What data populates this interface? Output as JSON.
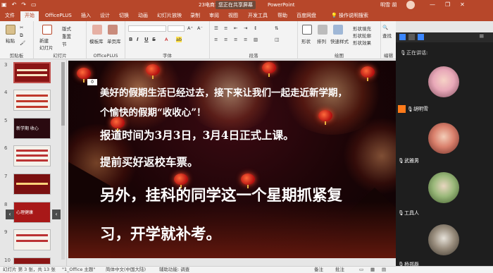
{
  "titlebar": {
    "qat_icons": [
      "save-icon",
      "undo-icon",
      "redo-icon",
      "present-icon"
    ],
    "file_title": "23电商1班",
    "share_badge": "您正在共享屏幕",
    "app_name": "PowerPoint",
    "user_name": "明雪 胡",
    "window_buttons": [
      "—",
      "❐",
      "✕"
    ]
  },
  "ribbon_tabs": {
    "file": "文件",
    "items": [
      "开始",
      "OfficePLUS",
      "插入",
      "设计",
      "切换",
      "动画",
      "幻灯片放映",
      "录制",
      "审阅",
      "视图",
      "开发工具",
      "帮助",
      "百度网盘"
    ],
    "search": "操作说明搜索"
  },
  "ribbon": {
    "clipboard": {
      "paste": "粘贴",
      "label": "剪贴板"
    },
    "slides": {
      "new_slide": "新建\n幻灯片",
      "layout": "版式",
      "reset": "重置",
      "section": "节",
      "label": "幻灯片"
    },
    "officeplus": {
      "template": "模板库",
      "single_page": "单页库",
      "label": "OfficePLUS"
    },
    "font": {
      "bold": "B",
      "italic": "I",
      "underline": "U",
      "strike": "S",
      "label": "字体"
    },
    "paragraph": {
      "label": "段落"
    },
    "drawing": {
      "shape": "形状",
      "arrange": "排列",
      "quick_styles": "快速样式",
      "fill": "形状填充",
      "outline": "形状轮廓",
      "effect": "形状效果",
      "label": "绘图"
    },
    "editing": {
      "find": "查找",
      "label": "编辑"
    }
  },
  "slide_panel": {
    "thumbnails": [
      {
        "num": "3",
        "selected": true,
        "text": ""
      },
      {
        "num": "4",
        "selected": false,
        "text": ""
      },
      {
        "num": "5",
        "selected": false,
        "text": "新学期 收心"
      },
      {
        "num": "6",
        "selected": false,
        "text": ""
      },
      {
        "num": "7",
        "selected": false,
        "text": ""
      },
      {
        "num": "8",
        "selected": false,
        "text": "心理健康"
      },
      {
        "num": "9",
        "selected": false,
        "text": ""
      },
      {
        "num": "10",
        "selected": false,
        "text": ""
      }
    ]
  },
  "slide": {
    "box_label": "0",
    "line1": "美好的假期生活已经过去，接下来让我们一起走近新学期，",
    "line2": "个愉快的假期“收收心”！",
    "line3": "报道时间为3月3日，3月4日正式上课。",
    "line4": "提前买好返校车票。",
    "line5": "另外，挂科的同学这一个星期抓紧复",
    "line6": "习，开学就补考。"
  },
  "meeting": {
    "speaking_label": "正在讲话:",
    "participants": [
      {
        "name": "胡明雪",
        "speaking": true
      },
      {
        "name": "武雅男",
        "speaking": false
      },
      {
        "name": "工具人",
        "speaking": false
      },
      {
        "name": "杨郑磊",
        "speaking": false
      }
    ]
  },
  "statusbar": {
    "slide_info": "幻灯片 第 3 张，共 13 张",
    "theme": "\"1_Office 主题\"",
    "language": "简体中文(中国大陆)",
    "accessibility": "辅助功能: 调查",
    "notes": "备注",
    "comments": "批注"
  },
  "colors": {
    "accent": "#b7472a",
    "slide_bg": "#1a0406",
    "meeting_bg": "#1e1e1e",
    "speaker_tag": "#ff7a1a"
  }
}
